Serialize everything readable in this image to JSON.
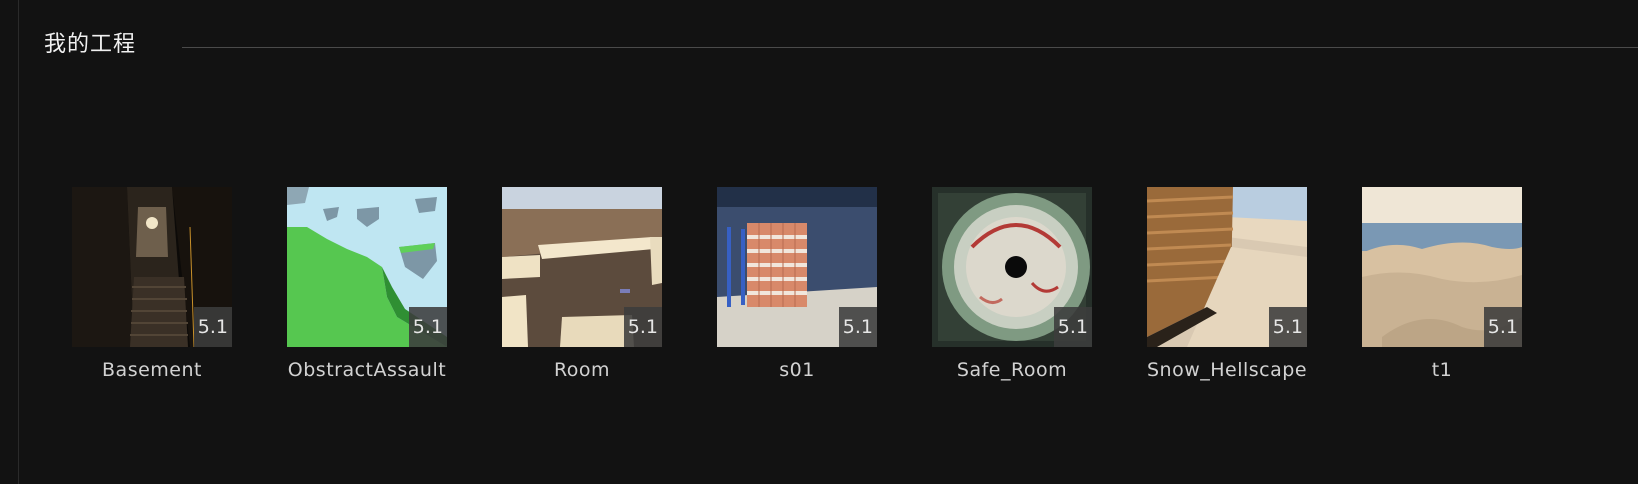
{
  "section": {
    "title": "我的工程"
  },
  "projects": [
    {
      "name": "Basement",
      "version": "5.1"
    },
    {
      "name": "ObstractAssault",
      "version": "5.1"
    },
    {
      "name": "Room",
      "version": "5.1"
    },
    {
      "name": "s01",
      "version": "5.1"
    },
    {
      "name": "Safe_Room",
      "version": "5.1"
    },
    {
      "name": "Snow_Hellscape",
      "version": "5.1"
    },
    {
      "name": "t1",
      "version": "5.1"
    }
  ]
}
